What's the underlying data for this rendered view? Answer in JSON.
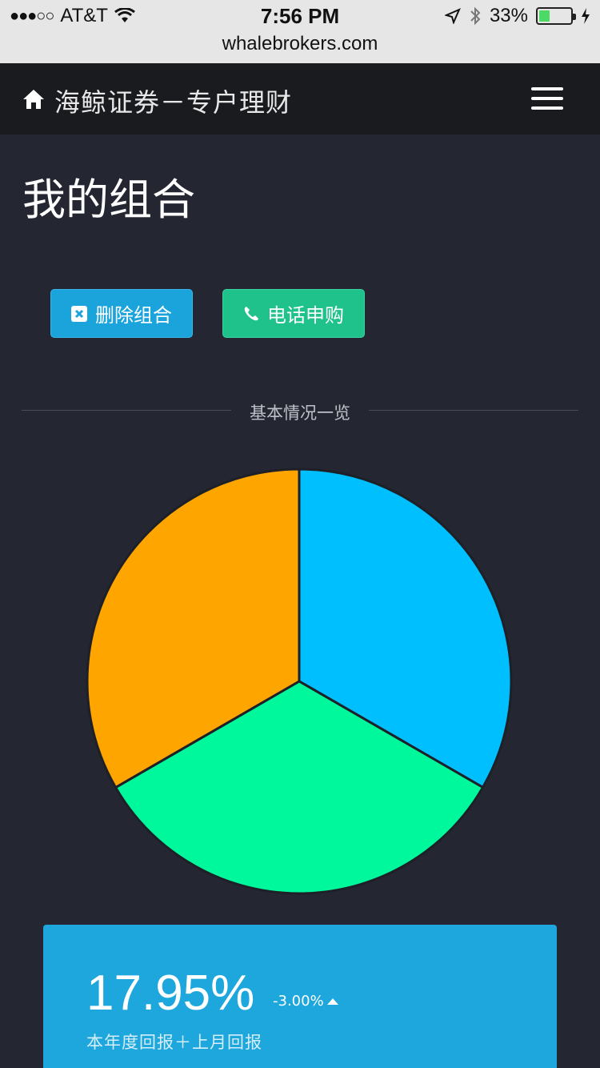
{
  "status_bar": {
    "carrier": "AT&T",
    "signal_dots": "●●●○○",
    "time": "7:56 PM",
    "battery": "33%",
    "battery_fill": 0.33
  },
  "browser": {
    "url": "whalebrokers.com"
  },
  "navbar": {
    "title": "海鲸证券－专户理财",
    "home_icon": "home-icon",
    "menu_icon": "hamburger-icon"
  },
  "page": {
    "title": "我的组合"
  },
  "buttons": {
    "delete_label": "删除组合",
    "phone_label": "电话申购"
  },
  "section": {
    "label": "基本情况一览"
  },
  "chart_data": {
    "type": "pie",
    "slices": [
      {
        "value": 33.33,
        "color": "#00bfff"
      },
      {
        "value": 33.33,
        "color": "#00f89c"
      },
      {
        "value": 33.34,
        "color": "#ffa500"
      }
    ]
  },
  "card": {
    "value": "17.95%",
    "change": "-3.00%",
    "label": "本年度回报＋上月回报"
  },
  "colors": {
    "accent_blue": "#1da7dd",
    "accent_green": "#1fc28a",
    "background": "#242632"
  }
}
